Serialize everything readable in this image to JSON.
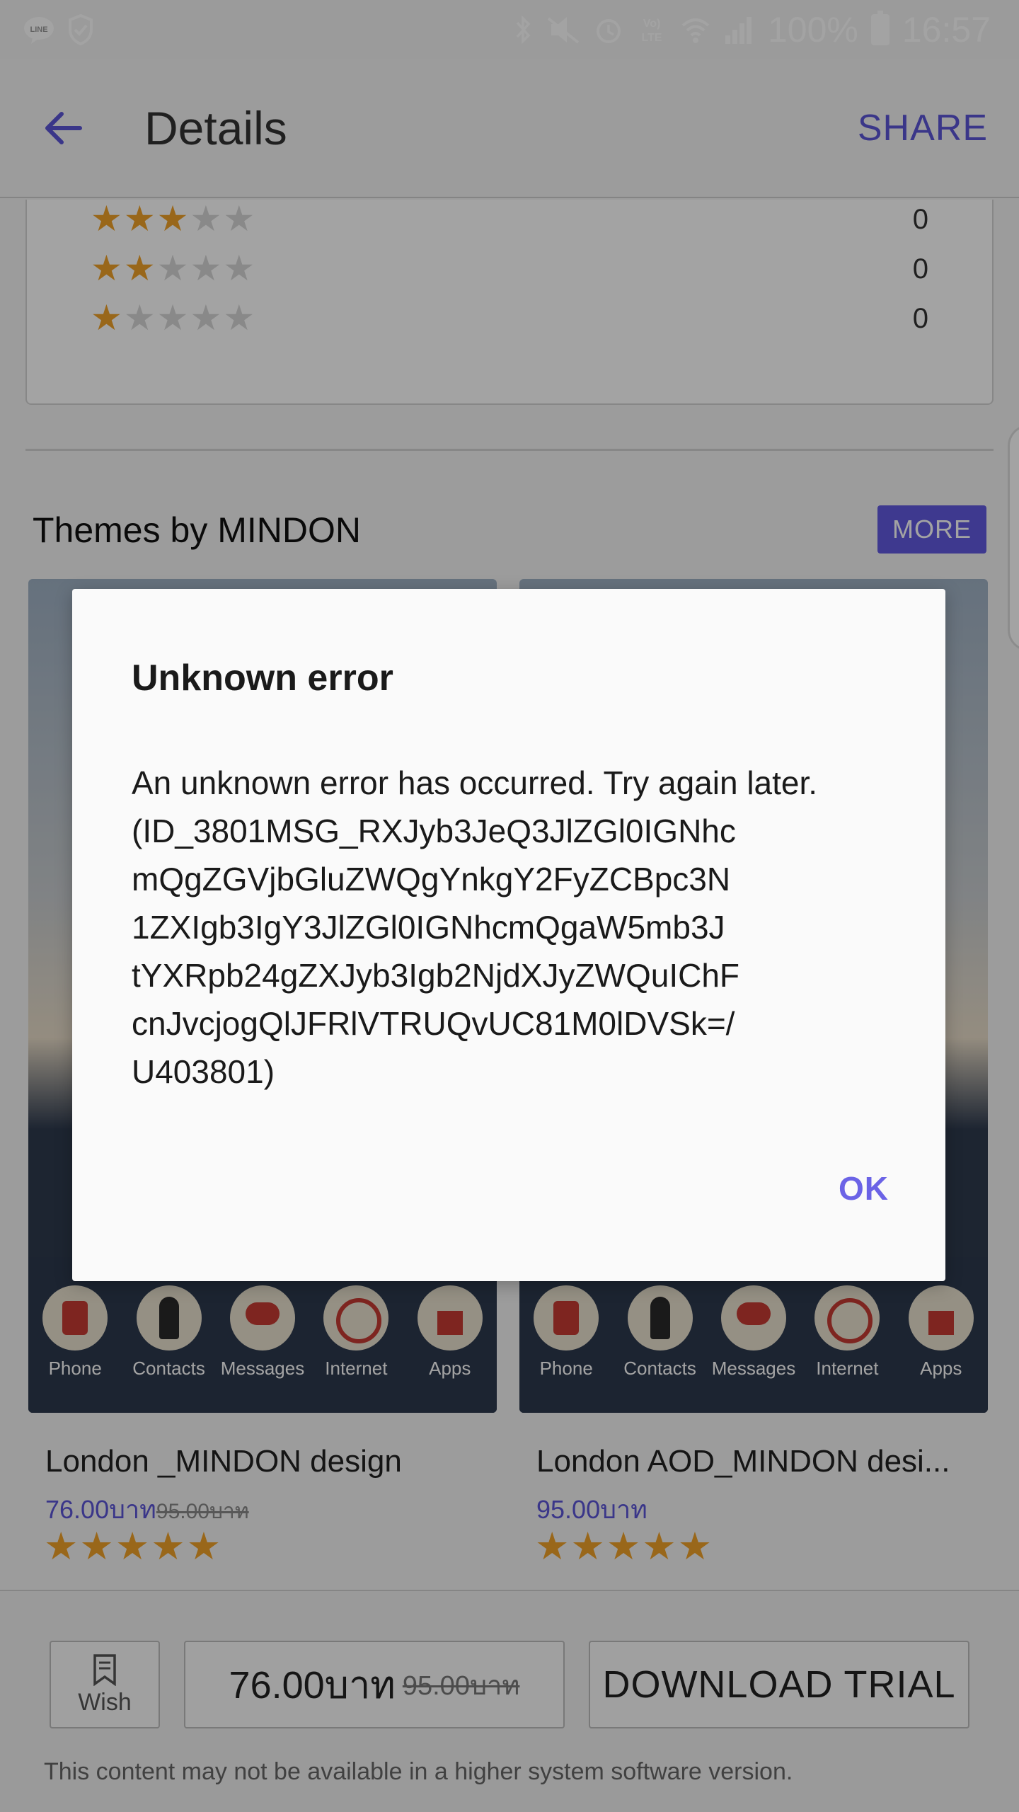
{
  "status_bar": {
    "battery": "100%",
    "time": "16:57",
    "left_icons": [
      "line-icon",
      "shield-check-icon"
    ],
    "right_icons": [
      "bluetooth-icon",
      "mute-icon",
      "alarm-icon",
      "volte-icon",
      "wifi-icon",
      "signal-icon",
      "battery-icon"
    ]
  },
  "app_bar": {
    "title": "Details",
    "share_label": "SHARE"
  },
  "ratings": [
    {
      "stars": 3,
      "count": "0"
    },
    {
      "stars": 2,
      "count": "0"
    },
    {
      "stars": 1,
      "count": "0"
    }
  ],
  "section": {
    "title": "Themes by MINDON",
    "more_label": "MORE"
  },
  "themes": [
    {
      "name": "London _MINDON design",
      "price": "76.00บาท",
      "old_price": "95.00บาท",
      "stars": 5,
      "dock": [
        "Phone",
        "Contacts",
        "Messages",
        "Internet",
        "Apps"
      ]
    },
    {
      "name": "London AOD_MINDON desi...",
      "price": "95.00บาท",
      "old_price": "",
      "stars": 5,
      "dock": [
        "Phone",
        "Contacts",
        "Messages",
        "Internet",
        "Apps"
      ]
    }
  ],
  "bottom_bar": {
    "wish_label": "Wish",
    "price": "76.00บาท",
    "old_price": "95.00บาท",
    "download_label": "DOWNLOAD TRIAL",
    "note": "This content may not be available in a higher system software version."
  },
  "dialog": {
    "title": "Unknown error",
    "message_lines": [
      "An unknown error has occurred. Try again later.",
      "(ID_3801MSG_RXJyb3JeQ3JlZGl0IGNhc",
      "mQgZGVjbGluZWQgYnkgY2FyZCBpc3N",
      "1ZXIgb3IgY3JlZGl0IGNhcmQgaW5mb3J",
      "tYXRpb24gZXJyb3Igb2NjdXJyZWQuIChF",
      "cnJvcjogQlJFRlVTRUQvUC81M0lDVSk=/",
      "U403801)"
    ],
    "ok_label": "OK"
  }
}
